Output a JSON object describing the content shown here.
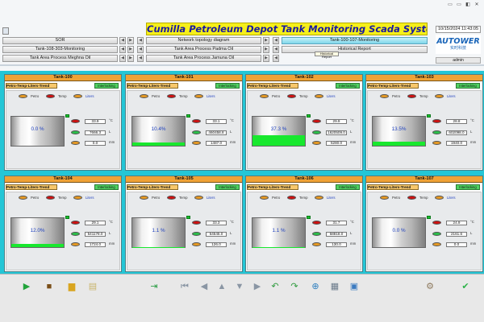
{
  "title": "Cumilla  Petroleum Depot Tank Monitoring Scada System",
  "datetime": "10/15/2024 11:43:05",
  "brand": "AUTOWER",
  "brand_sub": "实时科技",
  "user": "admin",
  "tooltip": "Historical Report",
  "nav": {
    "sor": "SOR",
    "topology": "Network topology diagram",
    "tank_100_107": "Tank-100-107-Monitoring",
    "tank_108_303": "Tank-108-303-Monitoring",
    "padma": "Tank Area Process Padma Oil",
    "historical": "Historical Report",
    "meghna": "Tank Area Process Meghna Oil",
    "jamuna": "Tank Area Process Jamuna Oil"
  },
  "labels": {
    "trend": "Petro-Temp-Liters-Trend",
    "interlock": "Interlocking",
    "petro": "Petro",
    "temp": "Temp",
    "liters": "Liters",
    "unit_temp": "°C",
    "unit_liters": "L",
    "unit_mm": "mm"
  },
  "tanks": [
    {
      "name": "Tank-100",
      "percent": "0.0",
      "pct_unit": "%",
      "level_fraction": 0.0,
      "temp": "33.9",
      "liters": "7666.3",
      "mm": "0.0"
    },
    {
      "name": "Tank-101",
      "percent": "10.4%",
      "pct_unit": "",
      "level_fraction": 0.104,
      "temp": "33.1",
      "liters": "460458.8",
      "mm": "1487.0"
    },
    {
      "name": "Tank-102",
      "percent": "37.3 %",
      "pct_unit": "",
      "level_fraction": 0.373,
      "temp": "29.9",
      "liters": "1620509.0",
      "mm": "5280.0"
    },
    {
      "name": "Tank-103",
      "percent": "13.5%",
      "pct_unit": "",
      "level_fraction": 0.135,
      "temp": "28.8",
      "liters": "602098.0",
      "mm": "1940.0"
    },
    {
      "name": "Tank-104",
      "percent": "12.0%",
      "pct_unit": "",
      "level_fraction": 0.12,
      "temp": "29.1",
      "liters": "541178.0",
      "mm": "1724.0"
    },
    {
      "name": "Tank-105",
      "percent": "1.1",
      "pct_unit": "%",
      "level_fraction": 0.011,
      "temp": "33.3",
      "liters": "54545.0",
      "mm": "126.0"
    },
    {
      "name": "Tank-106",
      "percent": "1.1",
      "pct_unit": "%",
      "level_fraction": 0.011,
      "temp": "31.7",
      "liters": "58818.0",
      "mm": "130.0"
    },
    {
      "name": "Tank-107",
      "percent": "0.0",
      "pct_unit": "%",
      "level_fraction": 0.0,
      "temp": "24.9",
      "liters": "2161.6",
      "mm": "0.0"
    }
  ],
  "toolbar": [
    {
      "name": "run-icon",
      "glyph": "▶",
      "color": "#21a33a"
    },
    {
      "name": "stop-icon",
      "glyph": "■",
      "color": "#7a4e18"
    },
    {
      "name": "folder-icon",
      "glyph": "▆",
      "color": "#d9a520"
    },
    {
      "name": "report-icon",
      "glyph": "▤",
      "color": "#c9b56b"
    },
    {
      "name": "import-icon",
      "glyph": "⇥",
      "color": "#2c9e46"
    },
    {
      "name": "first-page-icon",
      "glyph": "⏮",
      "color": "#8a96a4"
    },
    {
      "name": "prev-page-icon",
      "glyph": "◀",
      "color": "#8a96a4"
    },
    {
      "name": "up-icon",
      "glyph": "▲",
      "color": "#8a96a4"
    },
    {
      "name": "down-icon",
      "glyph": "▼",
      "color": "#8a96a4"
    },
    {
      "name": "next-page-icon",
      "glyph": "▶",
      "color": "#8a96a4"
    },
    {
      "name": "undo-icon",
      "glyph": "↶",
      "color": "#2f9b3f"
    },
    {
      "name": "redo-icon",
      "glyph": "↷",
      "color": "#2f9b3f"
    },
    {
      "name": "zoom-in-icon",
      "glyph": "⊕",
      "color": "#2f7fbf"
    },
    {
      "name": "print-icon",
      "glyph": "▦",
      "color": "#6b7b8b"
    },
    {
      "name": "save-icon",
      "glyph": "▣",
      "color": "#3a7ac0"
    },
    {
      "name": "settings-icon",
      "glyph": "⚙",
      "color": "#8e7a5e"
    },
    {
      "name": "confirm-icon",
      "glyph": "✔",
      "color": "#2eb34a"
    }
  ],
  "window_controls": [
    {
      "name": "window-icon-1",
      "glyph": "▭"
    },
    {
      "name": "window-icon-2",
      "glyph": "▭"
    },
    {
      "name": "window-icon-3",
      "glyph": "◧"
    },
    {
      "name": "close-icon",
      "glyph": "✕"
    }
  ]
}
